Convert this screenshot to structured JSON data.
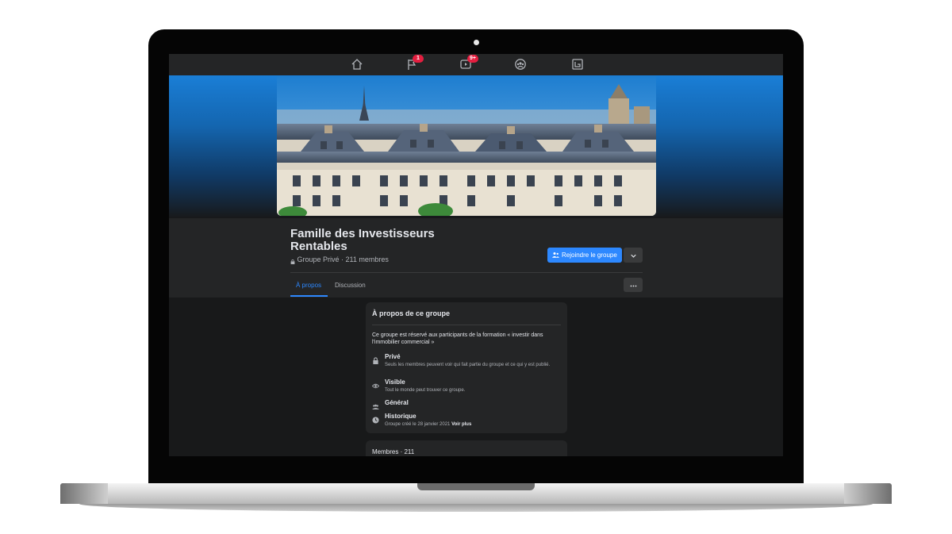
{
  "nav": {
    "items": [
      {
        "name": "home-icon"
      },
      {
        "name": "flag-icon",
        "badge": "1"
      },
      {
        "name": "video-icon",
        "badge": "9+"
      },
      {
        "name": "groups-icon"
      },
      {
        "name": "gaming-icon"
      }
    ]
  },
  "group": {
    "title": "Famille des Investisseurs Rentables",
    "meta": "Groupe Privé · 211 membres",
    "join_label": "Rejoindre le groupe"
  },
  "tabs": [
    {
      "label": "À propos",
      "active": true
    },
    {
      "label": "Discussion",
      "active": false
    }
  ],
  "about": {
    "title": "À propos de ce groupe",
    "description": "Ce groupe est réservé aux participants de la formation « investir dans l'immobilier commercial »",
    "rows": [
      {
        "icon": "lock-icon",
        "title": "Privé",
        "subtitle": "Seuls les membres peuvent voir qui fait partie du groupe et ce qui y est publié."
      },
      {
        "icon": "eye-icon",
        "title": "Visible",
        "subtitle": "Tout le monde peut trouver ce groupe."
      },
      {
        "icon": "people-icon",
        "title": "Général",
        "subtitle": ""
      },
      {
        "icon": "clock-icon",
        "title": "Historique",
        "subtitle": "Groupe créé le 28 janvier 2021",
        "link": "Voir plus"
      }
    ]
  },
  "members": {
    "title": "Membres · 211"
  },
  "colors": {
    "accent": "#2d88ff",
    "background": "#18191a",
    "card": "#242526",
    "badge": "#e41e3f"
  }
}
